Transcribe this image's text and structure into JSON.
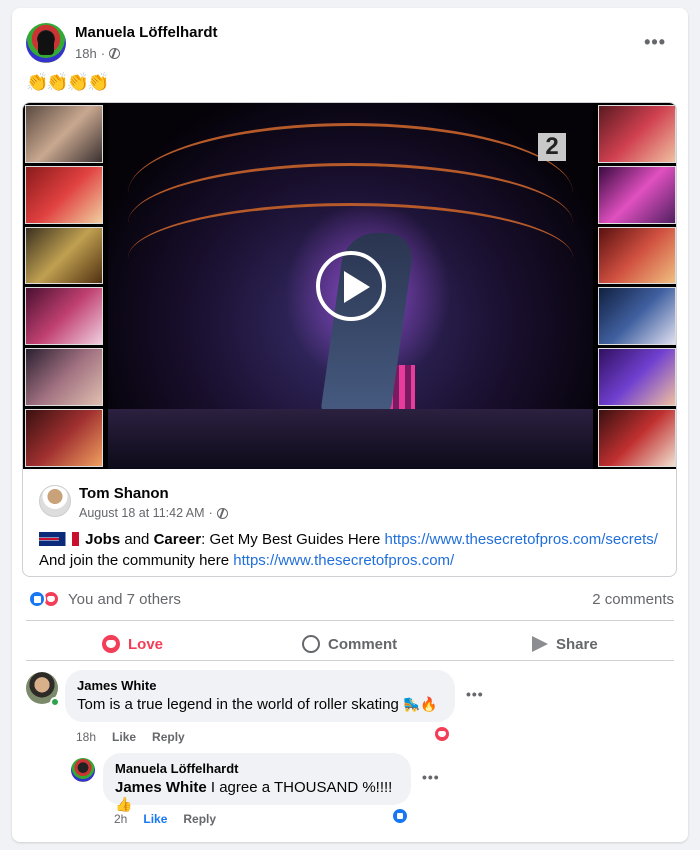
{
  "post": {
    "author": "Manuela Löffelhardt",
    "time": "18h",
    "time_sep": "·",
    "caption": "👏👏👏👏",
    "more": "•••"
  },
  "shared": {
    "author": "Tom Shanon",
    "time": "August 18 at 11:42 AM",
    "time_sep": "·",
    "line1_bold1": "Jobs",
    "line1_and": " and ",
    "line1_bold2": "Career",
    "line1_rest": ": Get My Best Guides Here ",
    "line1_link": "https://www.thesecretofpros.com/secrets/",
    "line2_text": "And join the community here ",
    "line2_link": "https://www.thesecretofpros.com/",
    "video_logo": "2"
  },
  "stats": {
    "reactions_text": "You and 7 others",
    "comments_count": "2 comments"
  },
  "actions": {
    "love": "Love",
    "comment": "Comment",
    "share": "Share"
  },
  "comments": [
    {
      "name": "James White",
      "text": "Tom is a true legend in the world of roller skating",
      "emoji": "🛼🔥",
      "time": "18h",
      "like": "Like",
      "reply": "Reply",
      "more": "•••"
    },
    {
      "name": "Manuela Löffelhardt",
      "mention": "James White",
      "text": " I agree a THOUSAND %!!!! ",
      "emoji": "👍",
      "time": "2h",
      "like": "Like",
      "reply": "Reply",
      "more": "•••"
    }
  ],
  "colors": {
    "accent_blue": "#1877f2",
    "love_red": "#f33e58",
    "link_blue": "#216fdb"
  }
}
